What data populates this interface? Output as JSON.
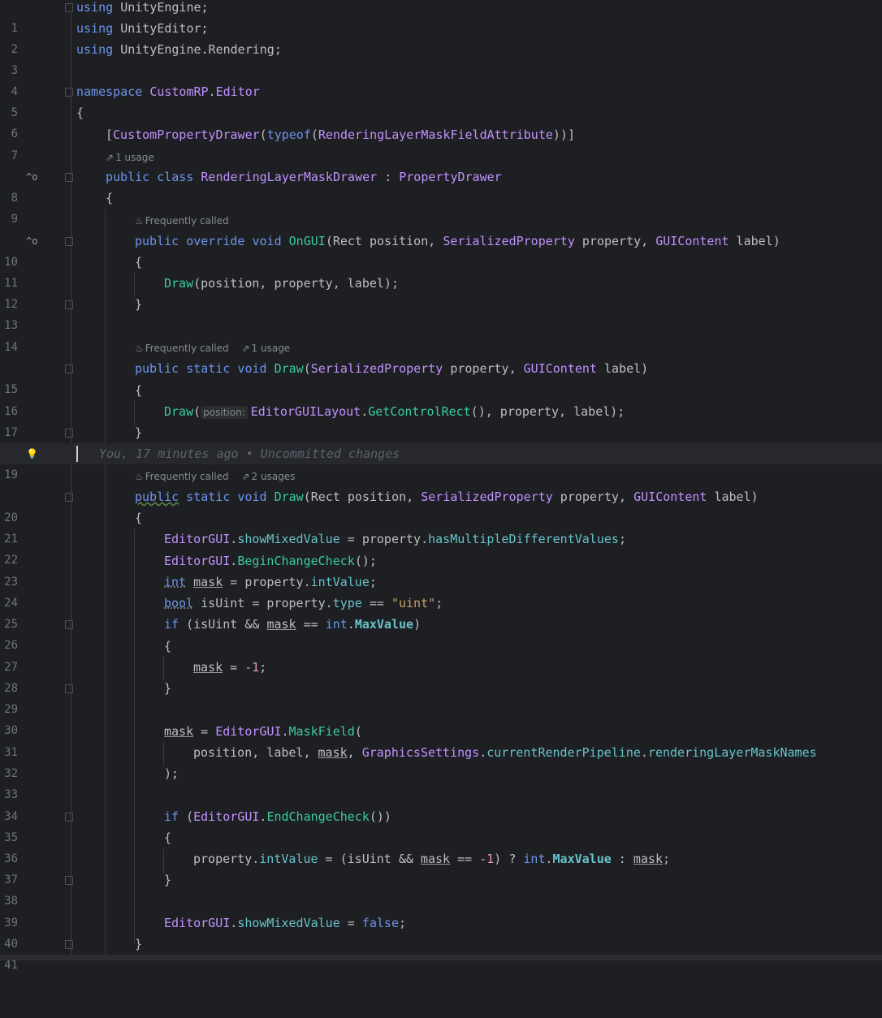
{
  "editor": {
    "lines": [
      {
        "n": "1",
        "code": "using UnityEngine;"
      },
      {
        "n": "2",
        "code": "using UnityEditor;"
      },
      {
        "n": "3",
        "code": "using UnityEngine.Rendering;"
      },
      {
        "n": "4",
        "code": ""
      },
      {
        "n": "5",
        "code": "namespace CustomRP.Editor"
      },
      {
        "n": "6",
        "code": "{"
      },
      {
        "n": "7",
        "code": "[CustomPropertyDrawer(typeof(RenderingLayerMaskFieldAttribute))]"
      },
      {
        "n": "8",
        "code": "public class RenderingLayerMaskDrawer : PropertyDrawer"
      },
      {
        "n": "9",
        "code": "{"
      },
      {
        "n": "10",
        "code": "public override void OnGUI(Rect position, SerializedProperty property, GUIContent label)"
      },
      {
        "n": "11",
        "code": "{"
      },
      {
        "n": "12",
        "code": "Draw(position, property, label);"
      },
      {
        "n": "13",
        "code": "}"
      },
      {
        "n": "14",
        "code": ""
      },
      {
        "n": "15",
        "code": "public static void Draw(SerializedProperty property, GUIContent label)"
      },
      {
        "n": "16",
        "code": "{"
      },
      {
        "n": "17",
        "code": "Draw(EditorGUILayout.GetControlRect(), property, label);"
      },
      {
        "n": "18",
        "code": "}"
      },
      {
        "n": "19",
        "code": ""
      },
      {
        "n": "20",
        "code": "public static void Draw(Rect position, SerializedProperty property, GUIContent label)"
      },
      {
        "n": "21",
        "code": "{"
      },
      {
        "n": "22",
        "code": "EditorGUI.showMixedValue = property.hasMultipleDifferentValues;"
      },
      {
        "n": "23",
        "code": "EditorGUI.BeginChangeCheck();"
      },
      {
        "n": "24",
        "code": "int mask = property.intValue;"
      },
      {
        "n": "25",
        "code": "bool isUint = property.type == \"uint\";"
      },
      {
        "n": "26",
        "code": "if (isUint && mask == int.MaxValue)"
      },
      {
        "n": "27",
        "code": "{"
      },
      {
        "n": "28",
        "code": "mask = -1;"
      },
      {
        "n": "29",
        "code": "}"
      },
      {
        "n": "30",
        "code": ""
      },
      {
        "n": "31",
        "code": "mask = EditorGUI.MaskField("
      },
      {
        "n": "32",
        "code": "position, label, mask, GraphicsSettings.currentRenderPipeline.renderingLayerMaskNames"
      },
      {
        "n": "33",
        "code": ");"
      },
      {
        "n": "34",
        "code": ""
      },
      {
        "n": "35",
        "code": "if (EditorGUI.EndChangeCheck())"
      },
      {
        "n": "36",
        "code": "{"
      },
      {
        "n": "37",
        "code": "property.intValue = (isUint && mask == -1) ? int.MaxValue : mask;"
      },
      {
        "n": "38",
        "code": "}"
      },
      {
        "n": "39",
        "code": ""
      },
      {
        "n": "40",
        "code": "EditorGUI.showMixedValue = false;"
      },
      {
        "n": "41",
        "code": "}"
      }
    ],
    "hints": {
      "usage_1": "1 usage",
      "frequently_called": "Frequently called",
      "usage_1b": "1 usage",
      "usages_2": "2 usages"
    },
    "inlay_position": "position:",
    "blame": "You, 17 minutes ago • Uncommitted changes",
    "icons": {
      "implements": "override-up-icon",
      "bulb": "lightbulb-icon",
      "usage": "usage-arrow-icon",
      "flame": "flame-icon"
    }
  }
}
